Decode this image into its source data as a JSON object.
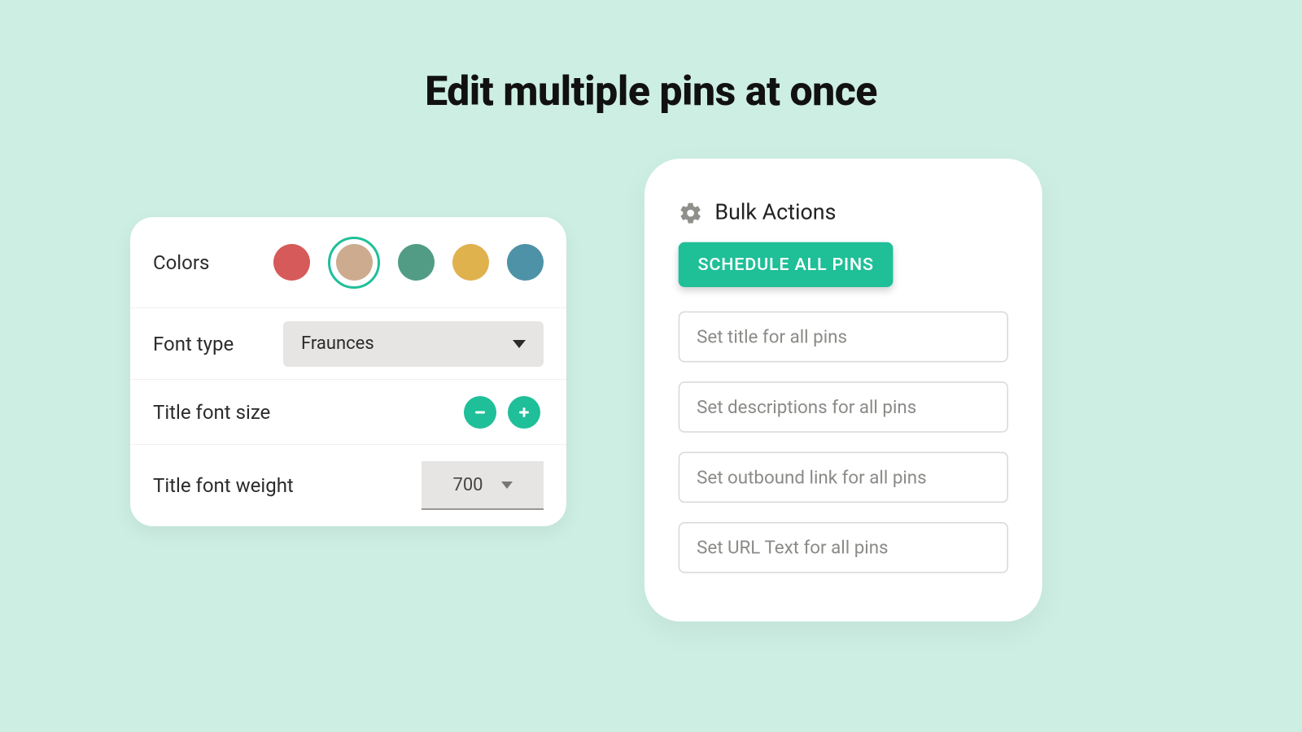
{
  "headline": "Edit multiple pins at once",
  "stylePanel": {
    "colors": {
      "label": "Colors",
      "swatches": [
        "#d65a59",
        "#ccab8e",
        "#529c85",
        "#e0b24e",
        "#4e92a7"
      ],
      "selectedIndex": 1,
      "ringColor": "#1fbf99"
    },
    "fontType": {
      "label": "Font type",
      "value": "Fraunces"
    },
    "titleFontSize": {
      "label": "Title font size"
    },
    "titleFontWeight": {
      "label": "Title font weight",
      "value": "700"
    }
  },
  "bulkPanel": {
    "title": "Bulk Actions",
    "scheduleButton": "SCHEDULE ALL PINS",
    "inputs": [
      "Set title for all pins",
      "Set descriptions for all pins",
      "Set outbound link for all pins",
      "Set URL Text for all pins"
    ]
  },
  "colors": {
    "accent": "#1fbf99"
  }
}
